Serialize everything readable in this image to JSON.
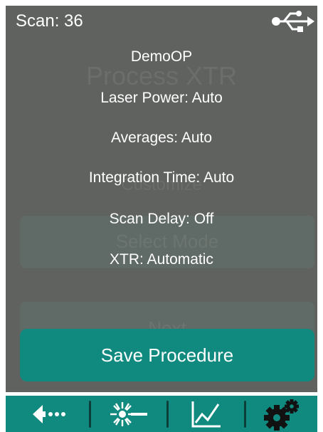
{
  "status": {
    "scan_label": "Scan: 36",
    "connection_icon": "usb-icon"
  },
  "background": {
    "title": "Process XTR",
    "subtitle": "Customize",
    "select_mode_label": "Select Mode",
    "next_label": "Next"
  },
  "procedure": {
    "name": "DemoOP",
    "settings": [
      "Laser Power: Auto",
      "Averages: Auto",
      "Integration Time: Auto",
      "Scan Delay: Off",
      "XTR: Automatic"
    ]
  },
  "actions": {
    "save_label": "Save Procedure"
  },
  "navbar": {
    "items": [
      {
        "icon": "back-arrow-icon"
      },
      {
        "icon": "laser-icon"
      },
      {
        "icon": "chart-icon"
      },
      {
        "icon": "settings-gears-icon"
      }
    ]
  },
  "colors": {
    "overlay_bg": "#5f625f",
    "accent_teal": "#10897f",
    "navbar_separator": "#0c3f3a",
    "text": "#ffffff"
  }
}
